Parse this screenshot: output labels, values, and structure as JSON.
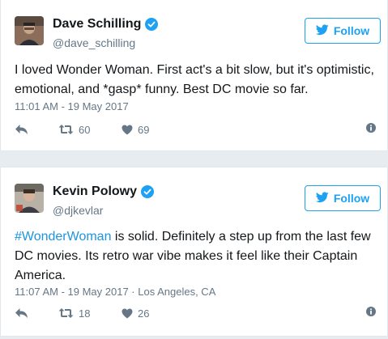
{
  "tweets": [
    {
      "display_name": "Dave Schilling",
      "handle": "@dave_schilling",
      "follow_label": "Follow",
      "text": "I loved Wonder Woman. First act's a bit slow, but it's optimistic, emotional, and *gasp* funny. Best DC movie so far.",
      "timestamp": "11:01 AM - 19 May 2017",
      "location": "",
      "retweets": "60",
      "likes": "69"
    },
    {
      "display_name": "Kevin Polowy",
      "handle": "@djkevlar",
      "follow_label": "Follow",
      "hashtag": "#WonderWoman",
      "text_rest": " is solid. Definitely a step up from the last few DC movies. Its retro war vibe makes it feel like their Captain America.",
      "timestamp": "11:07 AM - 19 May 2017",
      "separator": " · ",
      "location": "Los Angeles, CA",
      "retweets": "18",
      "likes": "26"
    }
  ],
  "colors": {
    "accent": "#1da1f2",
    "link": "#1b95e0",
    "muted": "#657786",
    "text": "#14171a",
    "background": "#e6ecf0"
  },
  "icons": [
    "verified-badge-icon",
    "twitter-bird-icon",
    "reply-icon",
    "retweet-icon",
    "heart-icon",
    "info-icon"
  ]
}
